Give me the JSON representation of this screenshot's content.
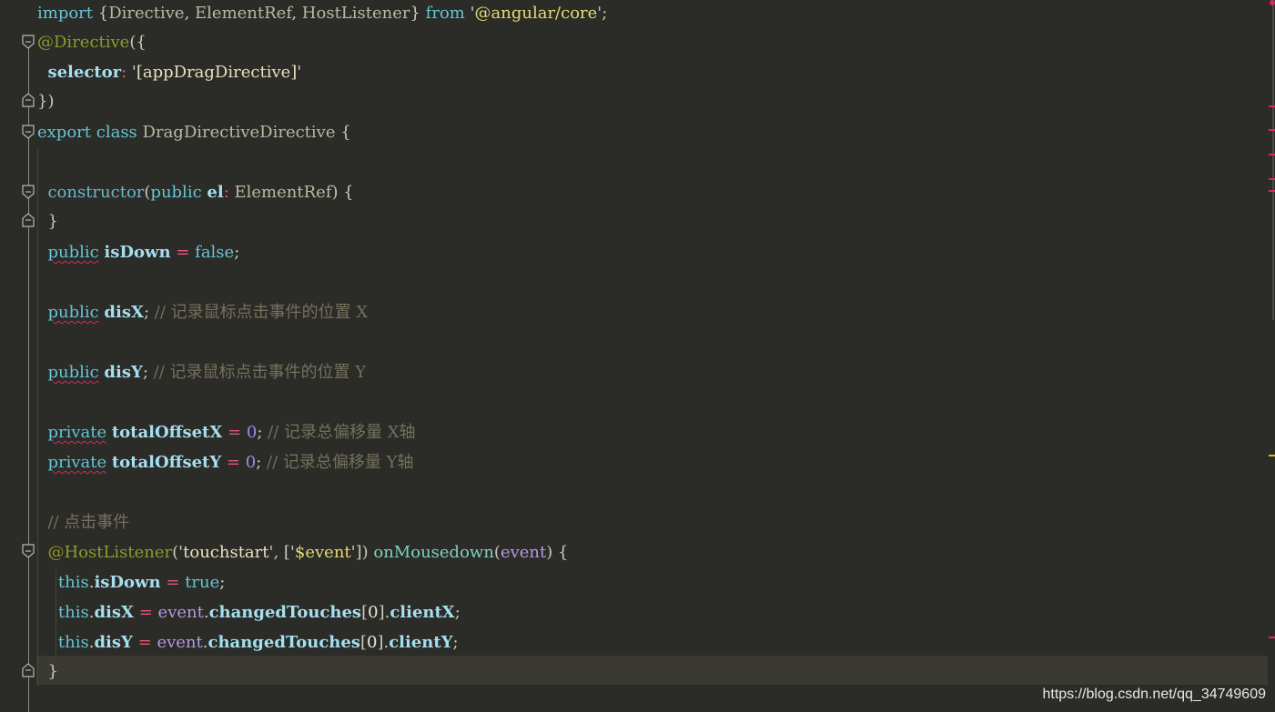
{
  "editor": {
    "lines": [
      [
        {
          "c": "kw",
          "t": "import"
        },
        {
          "c": "punc",
          "t": " {"
        },
        {
          "c": "cls",
          "t": "Directive"
        },
        {
          "c": "punc",
          "t": ", "
        },
        {
          "c": "cls",
          "t": "ElementRef"
        },
        {
          "c": "punc",
          "t": ", "
        },
        {
          "c": "cls",
          "t": "HostListener"
        },
        {
          "c": "punc",
          "t": "} "
        },
        {
          "c": "kw",
          "t": "from"
        },
        {
          "c": "punc",
          "t": " '"
        },
        {
          "c": "str",
          "t": "@angular/core"
        },
        {
          "c": "punc",
          "t": "';"
        }
      ],
      [
        {
          "c": "deco",
          "t": "@Directive"
        },
        {
          "c": "punc",
          "t": "({"
        }
      ],
      [
        {
          "c": "plain",
          "t": "  "
        },
        {
          "c": "prop",
          "t": "selector"
        },
        {
          "c": "op",
          "t": ":"
        },
        {
          "c": "punc",
          "t": " '"
        },
        {
          "c": "str2",
          "t": "[appDragDirective]"
        },
        {
          "c": "punc",
          "t": "'"
        }
      ],
      [
        {
          "c": "punc",
          "t": "})"
        }
      ],
      [
        {
          "c": "kw",
          "t": "export"
        },
        {
          "c": "plain",
          "t": " "
        },
        {
          "c": "kw",
          "t": "class"
        },
        {
          "c": "plain",
          "t": " "
        },
        {
          "c": "cls",
          "t": "DragDirectiveDirective"
        },
        {
          "c": "punc",
          "t": " {"
        }
      ],
      [],
      [
        {
          "c": "plain",
          "t": "  "
        },
        {
          "c": "kw2",
          "t": "constructor"
        },
        {
          "c": "punc",
          "t": "("
        },
        {
          "c": "kw",
          "t": "public"
        },
        {
          "c": "plain",
          "t": " "
        },
        {
          "c": "prop",
          "t": "el"
        },
        {
          "c": "op",
          "t": ":"
        },
        {
          "c": "plain",
          "t": " "
        },
        {
          "c": "cls",
          "t": "ElementRef"
        },
        {
          "c": "punc",
          "t": ") {"
        }
      ],
      [
        {
          "c": "punc",
          "t": "  }"
        }
      ],
      [
        {
          "c": "plain",
          "t": "  "
        },
        {
          "c": "kw squiggle",
          "t": "public"
        },
        {
          "c": "plain",
          "t": " "
        },
        {
          "c": "prop",
          "t": "isDown"
        },
        {
          "c": "plain",
          "t": " "
        },
        {
          "c": "op",
          "t": "="
        },
        {
          "c": "plain",
          "t": " "
        },
        {
          "c": "kw",
          "t": "false"
        },
        {
          "c": "punc",
          "t": ";"
        }
      ],
      [],
      [
        {
          "c": "plain",
          "t": "  "
        },
        {
          "c": "kw squiggle",
          "t": "public"
        },
        {
          "c": "plain",
          "t": " "
        },
        {
          "c": "prop",
          "t": "disX"
        },
        {
          "c": "punc",
          "t": "; "
        },
        {
          "c": "cmt",
          "t": "// 记录鼠标点击事件的位置 X"
        }
      ],
      [],
      [
        {
          "c": "plain",
          "t": "  "
        },
        {
          "c": "kw squiggle",
          "t": "public"
        },
        {
          "c": "plain",
          "t": " "
        },
        {
          "c": "prop",
          "t": "disY"
        },
        {
          "c": "punc",
          "t": "; "
        },
        {
          "c": "cmt",
          "t": "// 记录鼠标点击事件的位置 Y"
        }
      ],
      [],
      [
        {
          "c": "plain",
          "t": "  "
        },
        {
          "c": "kw squiggle",
          "t": "private"
        },
        {
          "c": "plain",
          "t": " "
        },
        {
          "c": "prop",
          "t": "totalOffsetX"
        },
        {
          "c": "plain",
          "t": " "
        },
        {
          "c": "op",
          "t": "="
        },
        {
          "c": "plain",
          "t": " "
        },
        {
          "c": "num",
          "t": "0"
        },
        {
          "c": "punc",
          "t": "; "
        },
        {
          "c": "cmt",
          "t": "// 记录总偏移量 X轴"
        }
      ],
      [
        {
          "c": "plain",
          "t": "  "
        },
        {
          "c": "kw squiggle",
          "t": "private"
        },
        {
          "c": "plain",
          "t": " "
        },
        {
          "c": "prop",
          "t": "totalOffsetY"
        },
        {
          "c": "plain",
          "t": " "
        },
        {
          "c": "op",
          "t": "="
        },
        {
          "c": "plain",
          "t": " "
        },
        {
          "c": "num",
          "t": "0"
        },
        {
          "c": "punc",
          "t": "; "
        },
        {
          "c": "cmt",
          "t": "// 记录总偏移量 Y轴"
        }
      ],
      [],
      [
        {
          "c": "plain",
          "t": "  "
        },
        {
          "c": "cmt",
          "t": "// 点击事件"
        }
      ],
      [
        {
          "c": "plain",
          "t": "  "
        },
        {
          "c": "deco",
          "t": "@HostListener"
        },
        {
          "c": "punc",
          "t": "('"
        },
        {
          "c": "str2",
          "t": "touchstart"
        },
        {
          "c": "punc",
          "t": "', ['"
        },
        {
          "c": "str",
          "t": "$event"
        },
        {
          "c": "punc",
          "t": "']) "
        },
        {
          "c": "fn2",
          "t": "onMousedown"
        },
        {
          "c": "punc",
          "t": "("
        },
        {
          "c": "param",
          "t": "event"
        },
        {
          "c": "punc",
          "t": ") {"
        }
      ],
      [
        {
          "c": "plain",
          "t": "    "
        },
        {
          "c": "kw",
          "t": "this"
        },
        {
          "c": "punc",
          "t": "."
        },
        {
          "c": "prop",
          "t": "isDown"
        },
        {
          "c": "plain",
          "t": " "
        },
        {
          "c": "op",
          "t": "="
        },
        {
          "c": "plain",
          "t": " "
        },
        {
          "c": "kw",
          "t": "true"
        },
        {
          "c": "punc",
          "t": ";"
        }
      ],
      [
        {
          "c": "plain",
          "t": "    "
        },
        {
          "c": "kw",
          "t": "this"
        },
        {
          "c": "punc",
          "t": "."
        },
        {
          "c": "prop",
          "t": "disX"
        },
        {
          "c": "plain",
          "t": " "
        },
        {
          "c": "op",
          "t": "="
        },
        {
          "c": "plain",
          "t": " "
        },
        {
          "c": "param",
          "t": "event"
        },
        {
          "c": "punc",
          "t": "."
        },
        {
          "c": "prop",
          "t": "changedTouches"
        },
        {
          "c": "punc",
          "t": "["
        },
        {
          "c": "plain",
          "t": "0"
        },
        {
          "c": "punc",
          "t": "]."
        },
        {
          "c": "prop",
          "t": "clientX"
        },
        {
          "c": "punc",
          "t": ";"
        }
      ],
      [
        {
          "c": "plain",
          "t": "    "
        },
        {
          "c": "kw",
          "t": "this"
        },
        {
          "c": "punc",
          "t": "."
        },
        {
          "c": "prop",
          "t": "disY"
        },
        {
          "c": "plain",
          "t": " "
        },
        {
          "c": "op",
          "t": "="
        },
        {
          "c": "plain",
          "t": " "
        },
        {
          "c": "param",
          "t": "event"
        },
        {
          "c": "punc",
          "t": "."
        },
        {
          "c": "prop",
          "t": "changedTouches"
        },
        {
          "c": "punc",
          "t": "["
        },
        {
          "c": "plain",
          "t": "0"
        },
        {
          "c": "punc",
          "t": "]."
        },
        {
          "c": "prop",
          "t": "clientY"
        },
        {
          "c": "punc",
          "t": ";"
        }
      ],
      [
        {
          "c": "punc",
          "t": "  }"
        }
      ]
    ]
  },
  "watermark": "https://blog.csdn.net/qq_34749609",
  "colors": {
    "background": "#2b2b27",
    "current_line": "#3a3a33",
    "error_mark": "#e0245e",
    "warning_mark": "#e6b422"
  }
}
